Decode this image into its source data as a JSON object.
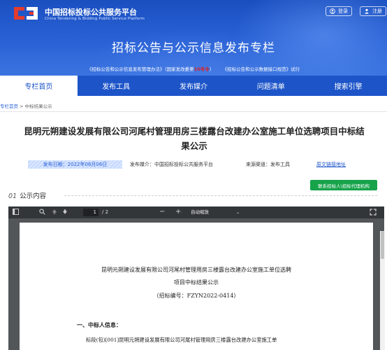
{
  "header": {
    "logo_cn": "中国招标投标公共服务平台",
    "logo_en": "China Tendering & Bidding Public Service Platform",
    "login_label": "登录",
    "register_label": "注册",
    "banner_title": "招标公告与公示信息发布专栏",
    "link_left_a": "《招标公告和公示信息发布管理办法》（国家发改委第",
    "link_left_red": "10号令",
    "link_left_b": "）",
    "link_right": "《招标公告和公示数据接口规范》试行"
  },
  "nav": {
    "items": [
      {
        "label": "专栏首页"
      },
      {
        "label": "发布工具"
      },
      {
        "label": "发布媒介"
      },
      {
        "label": "问题清单"
      },
      {
        "label": "搜索引擎"
      }
    ]
  },
  "breadcrumb": {
    "home": "专栏首页",
    "separator": " > ",
    "current": "中标结果公示"
  },
  "article": {
    "title_line1": "昆明元朔建设发展有限公司河尾村管理用房三楼露台改建办公室施工单位选聘项目中标结",
    "title_line2": "果公示",
    "date": "发布日期：2022年06月06日",
    "media": "发布媒介：中国招标投标公共服务平台",
    "source": "来源渠道：发布工具",
    "original_link": "原文链接地址",
    "contact_button": "联系招标人\\招标代理机构",
    "section_num": "01",
    "section_label": "公示内容"
  },
  "viewer": {
    "page_current": "1",
    "page_total": "/ 2",
    "zoom_label": "自动缩放",
    "doc_title_line1": "昆明元朔建设发展有限公司河尾村管理用房三楼露台改建办公室施工单位选聘",
    "doc_title_line2": "项目中标结果公示",
    "doc_code": "（招标编号：FZYN2022-0414）",
    "doc_heading": "一、中标人信息：",
    "doc_para": "标段(包)[001]昆明元朔建设发展有限公司河尾村管理用房三楼露台改建办公室施工单"
  },
  "colors": {
    "brand_blue": "#1d55c9",
    "green_button": "#16a34a",
    "red_emphasis": "#e02020"
  }
}
